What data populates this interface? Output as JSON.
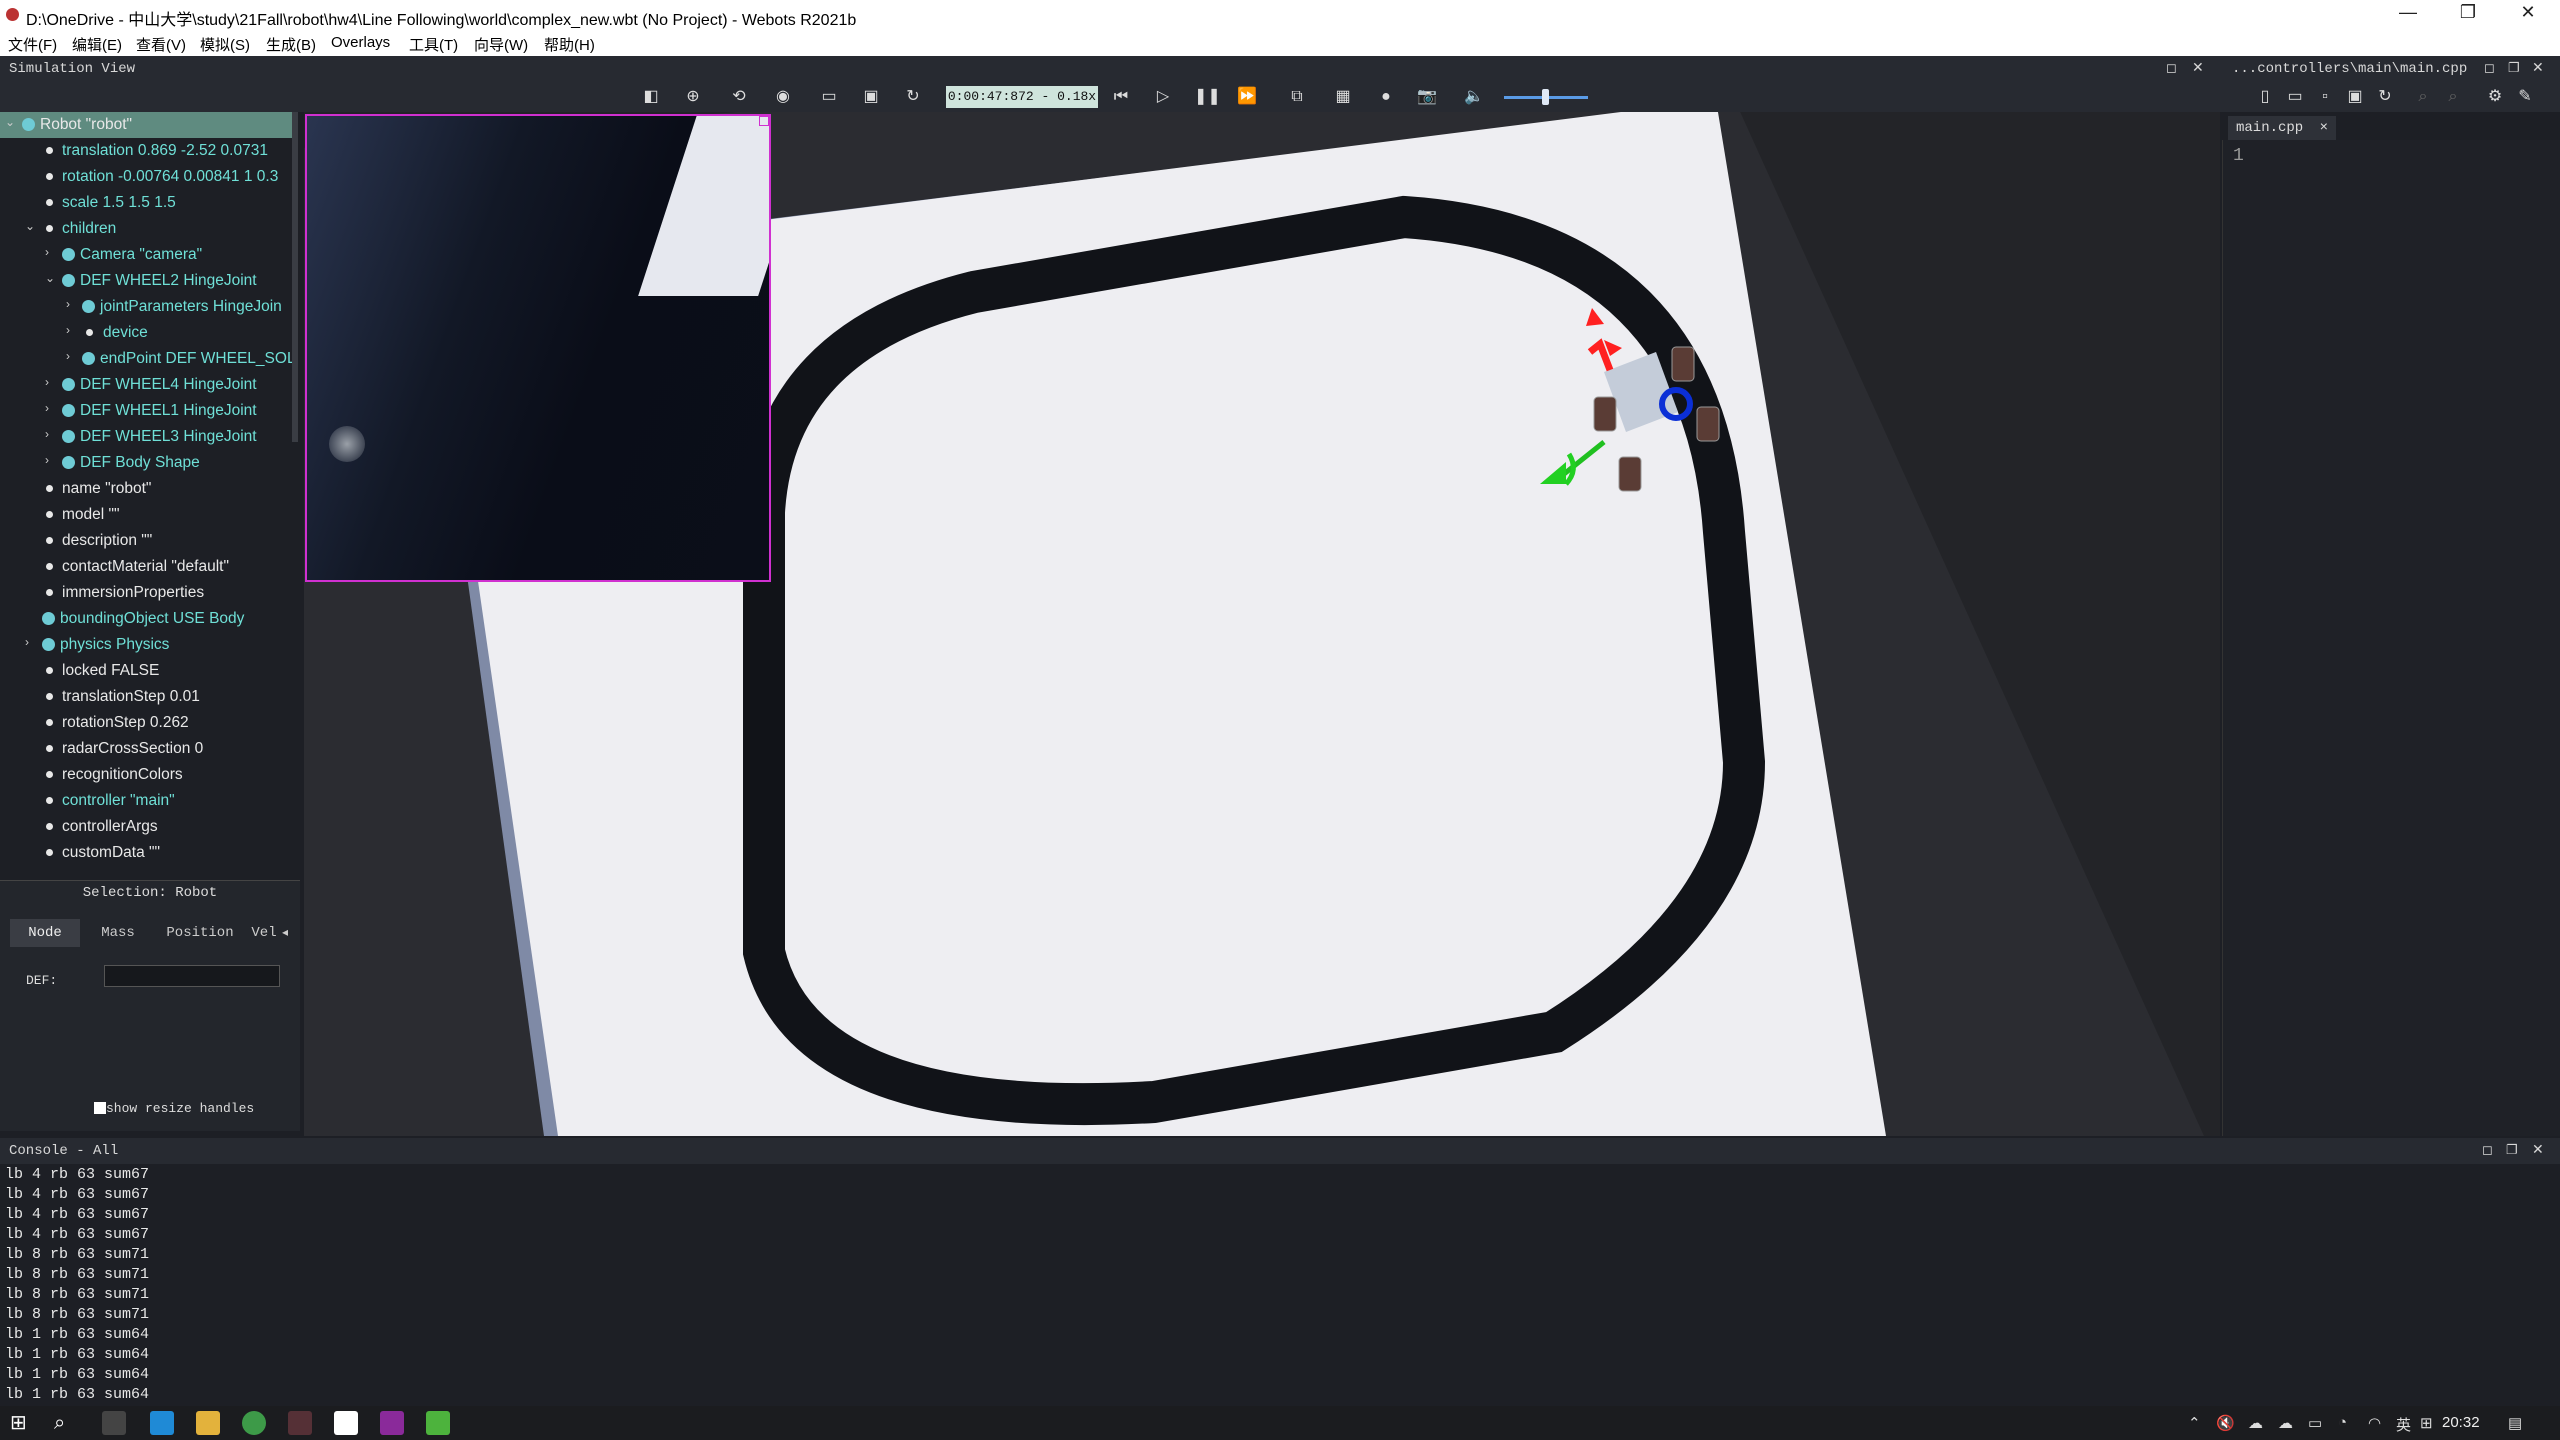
{
  "window": {
    "title": "D:\\OneDrive - 中山大学\\study\\21Fall\\robot\\hw4\\Line Following\\world\\complex_new.wbt (No Project) - Webots R2021b",
    "minimize": "—",
    "maximize": "❐",
    "close": "✕"
  },
  "menu": {
    "items": [
      "文件(F)",
      "编辑(E)",
      "查看(V)",
      "模拟(S)",
      "生成(B)",
      "Overlays",
      "工具(T)",
      "向导(W)",
      "帮助(H)"
    ]
  },
  "simulation": {
    "panel_title": "Simulation View",
    "time": "0:00:47:872 - 0.18x"
  },
  "scene_tree": {
    "items": [
      {
        "label": "Robot \"robot\"",
        "color": "white"
      },
      {
        "label": "translation 0.869 -2.52 0.0731",
        "color": "cyan"
      },
      {
        "label": "rotation -0.00764 0.00841 1 0.3",
        "color": "cyan"
      },
      {
        "label": "scale 1.5 1.5 1.5",
        "color": "cyan"
      },
      {
        "label": "children",
        "color": "cyan"
      },
      {
        "label": "Camera \"camera\"",
        "color": "cyan"
      },
      {
        "label": "DEF WHEEL2 HingeJoint",
        "color": "cyan"
      },
      {
        "label": "jointParameters HingeJoin",
        "color": "cyan"
      },
      {
        "label": "device",
        "color": "cyan"
      },
      {
        "label": "endPoint DEF WHEEL_SOLI",
        "color": "cyan"
      },
      {
        "label": "DEF WHEEL4 HingeJoint",
        "color": "cyan"
      },
      {
        "label": "DEF WHEEL1 HingeJoint",
        "color": "cyan"
      },
      {
        "label": "DEF WHEEL3 HingeJoint",
        "color": "cyan"
      },
      {
        "label": "DEF Body Shape",
        "color": "cyan"
      },
      {
        "label": "name \"robot\"",
        "color": "white"
      },
      {
        "label": "model \"\"",
        "color": "white"
      },
      {
        "label": "description \"\"",
        "color": "white"
      },
      {
        "label": "contactMaterial \"default\"",
        "color": "white"
      },
      {
        "label": "immersionProperties",
        "color": "white"
      },
      {
        "label": "boundingObject USE Body",
        "color": "cyan"
      },
      {
        "label": "physics Physics",
        "color": "cyan"
      },
      {
        "label": "locked FALSE",
        "color": "white"
      },
      {
        "label": "translationStep 0.01",
        "color": "white"
      },
      {
        "label": "rotationStep 0.262",
        "color": "white"
      },
      {
        "label": "radarCrossSection 0",
        "color": "white"
      },
      {
        "label": "recognitionColors",
        "color": "white"
      },
      {
        "label": "controller \"main\"",
        "color": "cyan"
      },
      {
        "label": "controllerArgs",
        "color": "white"
      },
      {
        "label": "customData \"\"",
        "color": "white"
      }
    ]
  },
  "selection": {
    "title": "Selection: Robot",
    "tabs": [
      "Node",
      "Mass",
      "Position",
      "Vel"
    ],
    "def_label": "DEF:",
    "def_value": "",
    "show_resize_handles": "show resize handles"
  },
  "editor": {
    "panel_title": "...controllers\\main\\main.cpp",
    "tab_label": "main.cpp",
    "tab_close": "×",
    "line_number": "1"
  },
  "console": {
    "title": "Console - All",
    "lines": [
      "lb 4 rb 63 sum67",
      "lb 4 rb 63 sum67",
      "lb 4 rb 63 sum67",
      "lb 4 rb 63 sum67",
      "lb 8 rb 63 sum71",
      "lb 8 rb 63 sum71",
      "lb 8 rb 63 sum71",
      "lb 8 rb 63 sum71",
      "lb 1 rb 63 sum64",
      "lb 1 rb 63 sum64",
      "lb 1 rb 63 sum64",
      "lb 1 rb 63 sum64"
    ]
  },
  "taskbar": {
    "time": "20:32",
    "ime": "英"
  },
  "colors": {
    "accent": "#6fe0d7",
    "selected_row": "#5f8b80",
    "time_box": "#cfe4dc"
  }
}
